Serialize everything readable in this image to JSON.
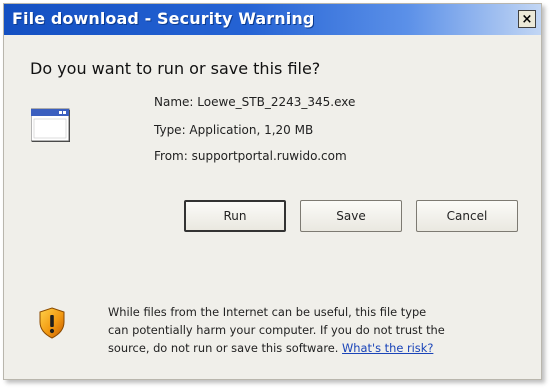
{
  "dialog": {
    "title": "File download - Security Warning",
    "close_label": "×",
    "question": "Do you want to run or save this file?"
  },
  "file": {
    "name_line": "Name:  Loewe_STB_2243_345.exe",
    "type_line": "Type:  Application, 1,20 MB",
    "from_line": "From:  supportportal.ruwido.com",
    "icon": "application-window-icon"
  },
  "buttons": {
    "run": "Run",
    "save": "Save",
    "cancel": "Cancel"
  },
  "warning": {
    "icon": "security-shield-warning-icon",
    "text": "While files from the Internet can be useful, this file type can potentially harm your computer. If you do not trust the source, do not run or save this software.",
    "link": "What's the risk?"
  },
  "colors": {
    "title_bar": "#1450c2",
    "dialog_bg": "#f0efea",
    "link": "#1a44b8",
    "shield_orange": "#f29a12"
  }
}
